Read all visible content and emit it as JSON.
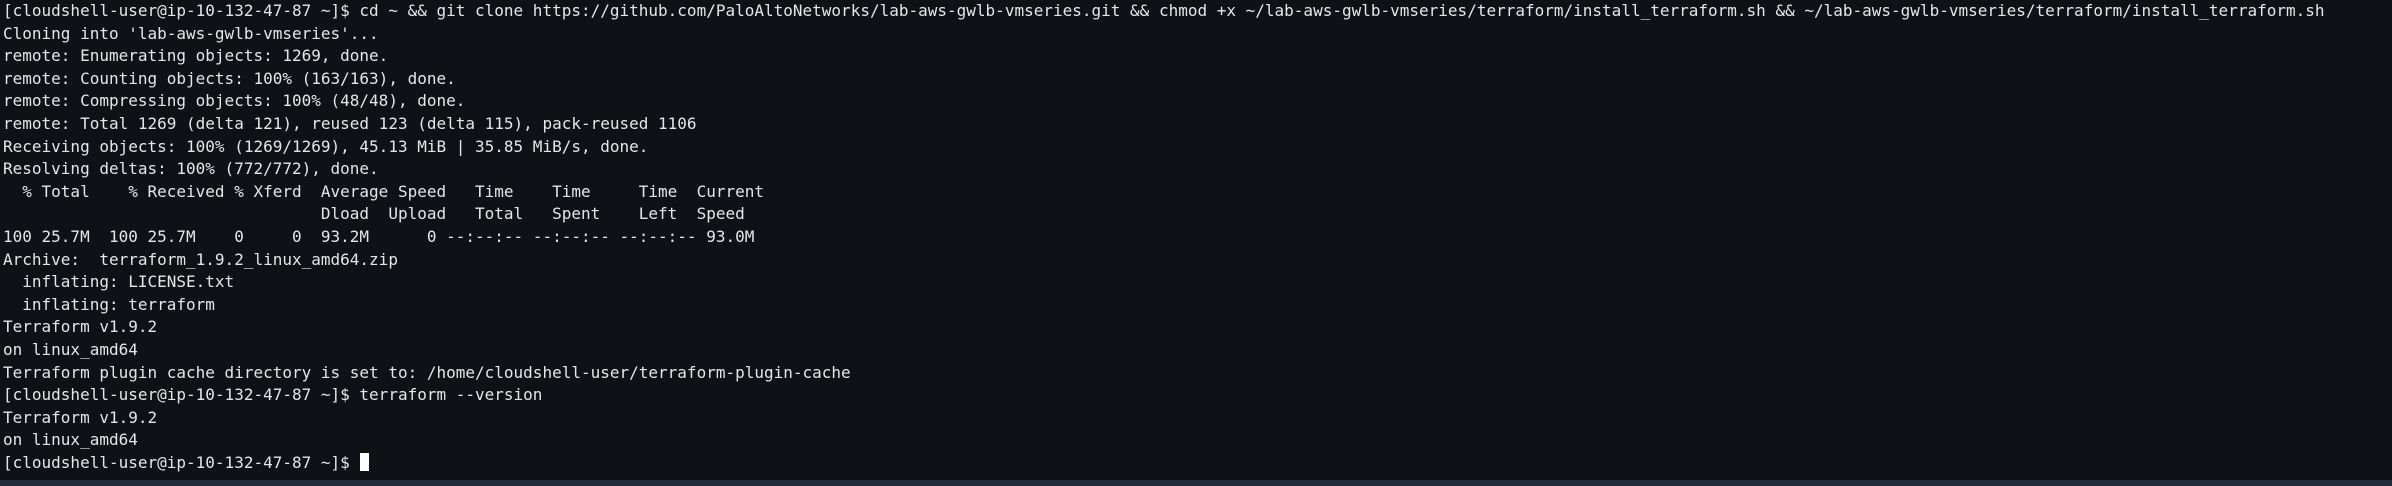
{
  "terminal": {
    "lines": [
      "[cloudshell-user@ip-10-132-47-87 ~]$ cd ~ && git clone https://github.com/PaloAltoNetworks/lab-aws-gwlb-vmseries.git && chmod +x ~/lab-aws-gwlb-vmseries/terraform/install_terraform.sh && ~/lab-aws-gwlb-vmseries/terraform/install_terraform.sh",
      "Cloning into 'lab-aws-gwlb-vmseries'...",
      "remote: Enumerating objects: 1269, done.",
      "remote: Counting objects: 100% (163/163), done.",
      "remote: Compressing objects: 100% (48/48), done.",
      "remote: Total 1269 (delta 121), reused 123 (delta 115), pack-reused 1106",
      "Receiving objects: 100% (1269/1269), 45.13 MiB | 35.85 MiB/s, done.",
      "Resolving deltas: 100% (772/772), done.",
      "  % Total    % Received % Xferd  Average Speed   Time    Time     Time  Current",
      "                                 Dload  Upload   Total   Spent    Left  Speed",
      "100 25.7M  100 25.7M    0     0  93.2M      0 --:--:-- --:--:-- --:--:-- 93.0M",
      "Archive:  terraform_1.9.2_linux_amd64.zip",
      "  inflating: LICENSE.txt",
      "  inflating: terraform",
      "Terraform v1.9.2",
      "on linux_amd64",
      "Terraform plugin cache directory is set to: /home/cloudshell-user/terraform-plugin-cache",
      "[cloudshell-user@ip-10-132-47-87 ~]$ terraform --version",
      "Terraform v1.9.2",
      "on linux_amd64",
      "[cloudshell-user@ip-10-132-47-87 ~]$ "
    ]
  }
}
